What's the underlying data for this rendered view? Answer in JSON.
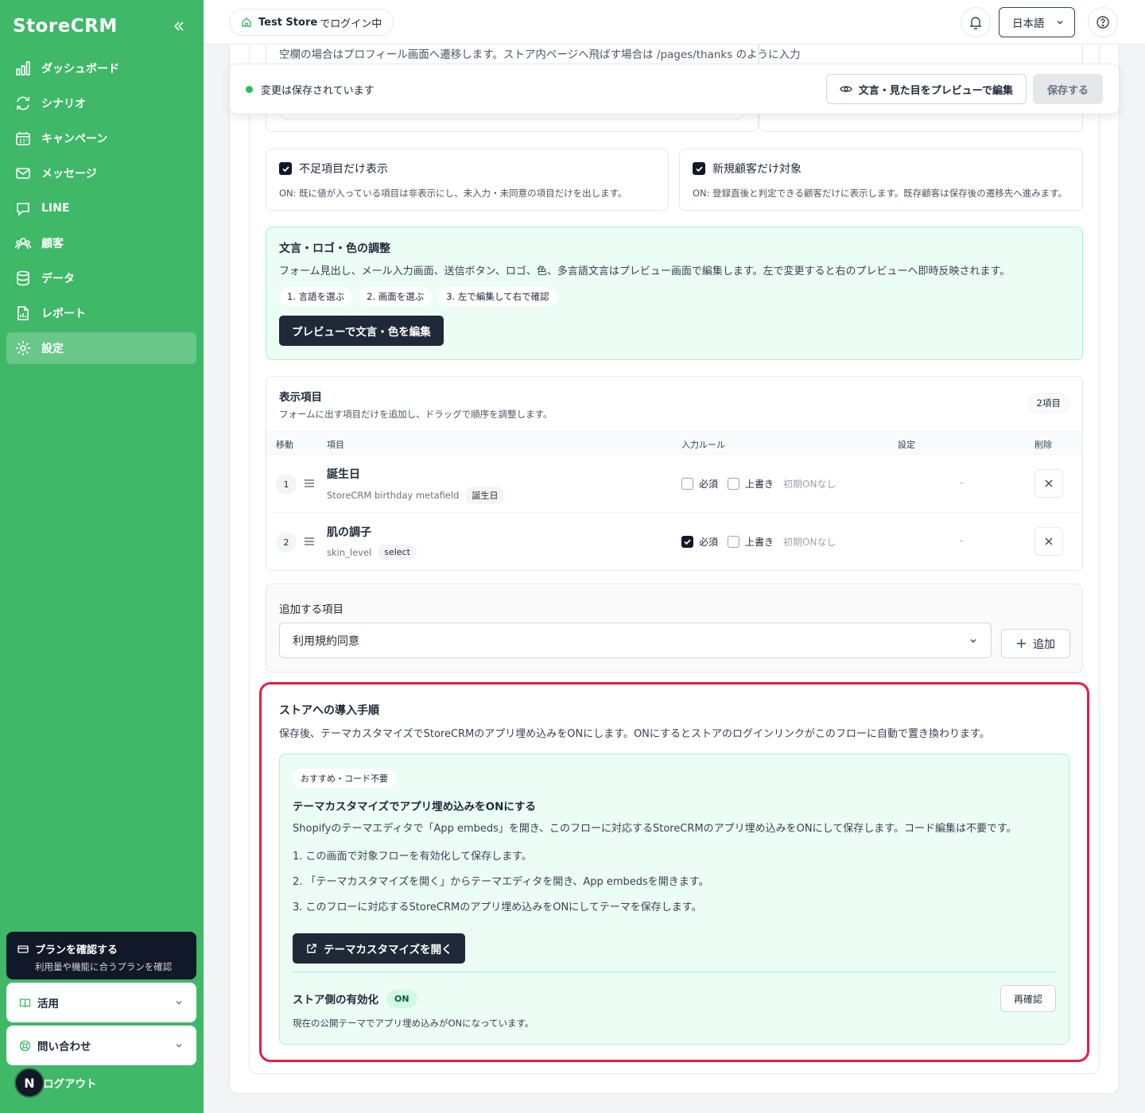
{
  "sidebar": {
    "brand": "StoreCRM",
    "items": [
      {
        "label": "ダッシュボード"
      },
      {
        "label": "シナリオ"
      },
      {
        "label": "キャンペーン"
      },
      {
        "label": "メッセージ"
      },
      {
        "label": "LINE"
      },
      {
        "label": "顧客"
      },
      {
        "label": "データ"
      },
      {
        "label": "レポート"
      },
      {
        "label": "設定"
      }
    ],
    "plan": {
      "title": "プランを確認する",
      "subtitle": "利用量や機能に合うプランを確認"
    },
    "usage": "活用",
    "contact": "問い合わせ",
    "avatar": "N",
    "logout": "ログアウト"
  },
  "topbar": {
    "store_name": "Test Store",
    "store_suffix": "でログイン中",
    "language": "日本語"
  },
  "clipped": {
    "text": "空欄の場合はプロフィール画面へ遷移します。ストア内ページへ飛ばす場合は /pages/thanks のように入力"
  },
  "savebar": {
    "status": "変更は保存されています",
    "preview_button": "文言・見た目をプレビューで編集",
    "save_button": "保存する"
  },
  "toggles": [
    {
      "label": "不足項目だけ表示",
      "desc": "ON: 既に値が入っている項目は非表示にし、未入力・未同意の項目だけを出します。",
      "checked": true
    },
    {
      "label": "新規顧客だけ対象",
      "desc": "ON: 登録直後と判定できる顧客だけに表示します。既存顧客は保存後の遷移先へ進みます。",
      "checked": true
    }
  ],
  "adjust": {
    "title": "文言・ロゴ・色の調整",
    "desc": "フォーム見出し、メール入力画面、送信ボタン、ロゴ、色、多言語文言はプレビュー画面で編集します。左で変更すると右のプレビューへ即時反映されます。",
    "steps": [
      "1. 言語を選ぶ",
      "2. 画面を選ぶ",
      "3. 左で編集して右で確認"
    ],
    "button": "プレビューで文言・色を編集"
  },
  "fields": {
    "title": "表示項目",
    "subtitle": "フォームに出す項目だけを追加し、ドラッグで順序を調整します。",
    "count": "2項目",
    "columns": {
      "move": "移動",
      "item": "項目",
      "rule": "入力ルール",
      "setting": "設定",
      "delete": "削除"
    },
    "rows": [
      {
        "num": "1",
        "name": "誕生日",
        "key": "StoreCRM birthday metafield",
        "tag": "誕生日",
        "required": "必須",
        "overwrite": "上書き",
        "initial": "初期ONなし",
        "setting": "-",
        "required_checked": false
      },
      {
        "num": "2",
        "name": "肌の調子",
        "key": "skin_level",
        "tag": "select",
        "required": "必須",
        "overwrite": "上書き",
        "initial": "初期ONなし",
        "setting": "-",
        "required_checked": true
      }
    ]
  },
  "add": {
    "label": "追加する項目",
    "selected": "利用規約同意",
    "button": "追加"
  },
  "install": {
    "title": "ストアへの導入手順",
    "desc": "保存後、テーマカスタマイズでStoreCRMのアプリ埋め込みをONにします。ONにするとストアのログインリンクがこのフローに自動で置き換わります。",
    "badge": "おすすめ・コード不要",
    "rec_title": "テーマカスタマイズでアプリ埋め込みをONにする",
    "rec_desc": "Shopifyのテーマエディタで「App embeds」を開き、このフローに対応するStoreCRMのアプリ埋め込みをONにして保存します。コード編集は不要です。",
    "steps": [
      "1. この画面で対象フローを有効化して保存します。",
      "2. 「テーマカスタマイズを開く」からテーマエディタを開き、App embedsを開きます。",
      "3. このフローに対応するStoreCRMのアプリ埋め込みをONにしてテーマを保存します。"
    ],
    "button": "テーマカスタマイズを開く",
    "enable_title": "ストア側の有効化",
    "enable_badge": "ON",
    "recheck": "再確認",
    "enable_desc": "現在の公開テーマでアプリ埋め込みがONになっています。"
  },
  "colors": {
    "sidebar": "#3fb868",
    "accent_red": "#e11d48",
    "mint": "#ecfdf5",
    "dark": "#1f2937"
  }
}
